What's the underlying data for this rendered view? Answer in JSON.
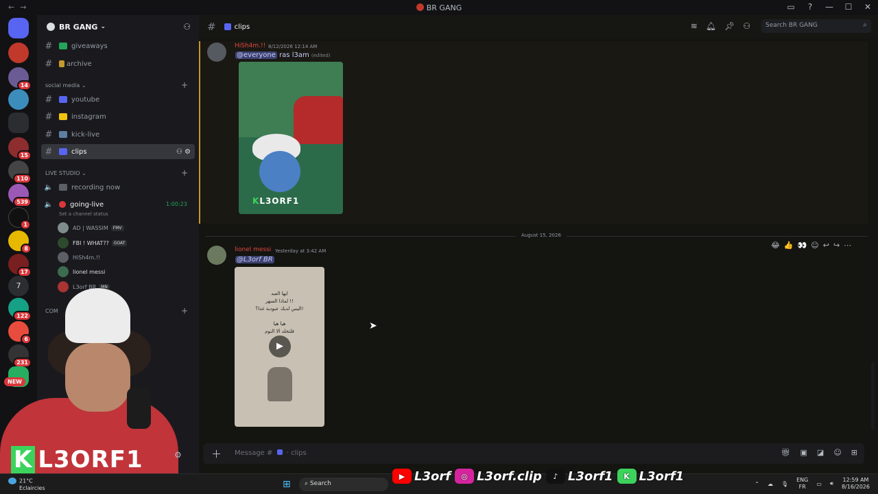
{
  "window": {
    "title": "BR GANG",
    "controls": [
      "—",
      "☐",
      "✕"
    ]
  },
  "guild": {
    "name": "BR GANG"
  },
  "channels": {
    "top_items": [
      {
        "label": "giveaways",
        "prefix": "·"
      },
      {
        "label": "archive"
      }
    ],
    "social_category": "social media",
    "social_items": [
      {
        "label": "youtube"
      },
      {
        "label": "instagram"
      },
      {
        "label": "kick-live"
      },
      {
        "label": "clips"
      }
    ],
    "live_category": "LIVE STUDIO",
    "voice_items": [
      {
        "label": "recording now"
      },
      {
        "label": "going-live",
        "timer": "1:00:23"
      }
    ],
    "set_status": "Set a channel status",
    "voice_users": [
      {
        "name": "AD | WASSIM",
        "tag": "FMV"
      },
      {
        "name": "FBI ! WHAT??",
        "tag": "GOAT"
      },
      {
        "name": "HiSh4m.!!",
        "tag": ""
      },
      {
        "name": "lionel messi",
        "tag": ""
      },
      {
        "name": "L3orf BR",
        "tag": "MN"
      }
    ],
    "com_category": "COM"
  },
  "header": {
    "channel": "clips",
    "search_placeholder": "Search BR GANG"
  },
  "messages": [
    {
      "author": "HiSh4m.!!",
      "time": "8/12/2026 12:14 AM",
      "mention": "@everyone",
      "text": "ras l3am",
      "edited": "(edited)",
      "image_brand": "L3ORF1"
    },
    {
      "author": "lionel messi",
      "time": "Yesterday at 3:42 AM",
      "mention": "@L3orf BR",
      "video_text": [
        "ايها العبد",
        "لماذا السهر !!",
        "اليس لديك عبودية غدا؟!"
      ],
      "video_text2": [
        "هيا هيا",
        "فلتخلد الا النوم"
      ]
    }
  ],
  "date_divider": "August 15, 2026",
  "composer": {
    "placeholder": "Message #",
    "channel": "clips"
  },
  "overlay": {
    "brand": "L3ORF1",
    "socials": [
      "L3orf",
      "L3orf.clip",
      "L3orf1",
      "L3orf1"
    ]
  },
  "server_badges": [
    "14",
    "15",
    "110",
    "539",
    "1",
    "8",
    "17",
    "7",
    "122",
    "6",
    "231"
  ],
  "new_badge": "NEW",
  "taskbar": {
    "temp": "21°C",
    "weather": "Eclaircies",
    "search": "Search",
    "lang1": "ENG",
    "lang2": "FR",
    "time": "12:59 AM",
    "date": "8/16/2026"
  }
}
